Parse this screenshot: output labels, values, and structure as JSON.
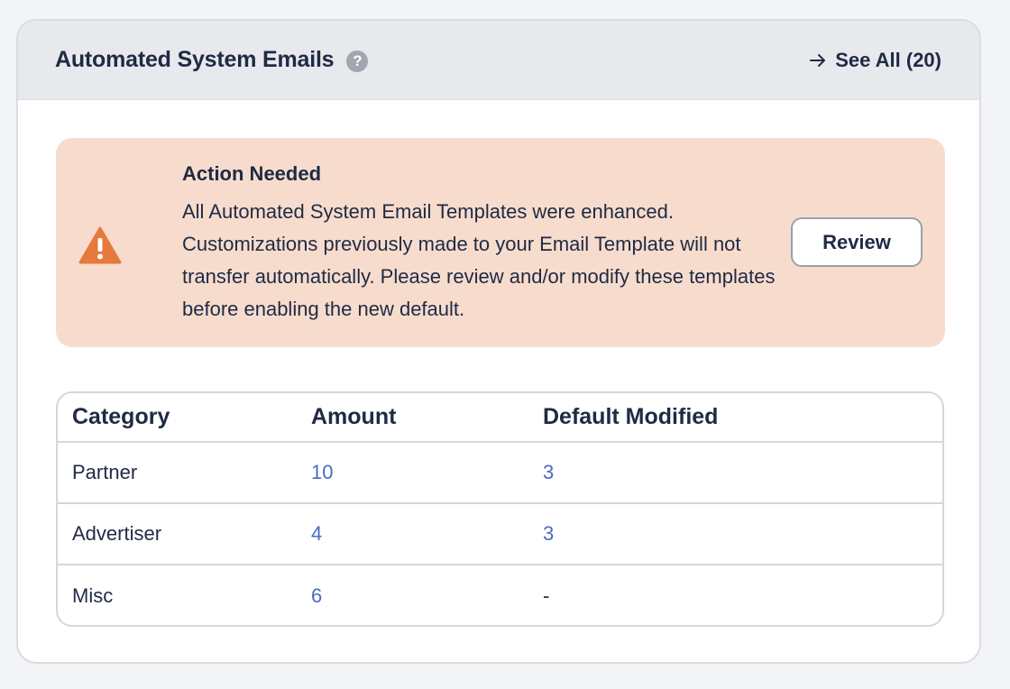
{
  "header": {
    "title": "Automated System Emails",
    "help_icon": "question-circle-icon",
    "see_all_label": "See All (20)",
    "see_all_icon": "arrow-right-icon"
  },
  "alert": {
    "icon": "warning-triangle-icon",
    "title": "Action Needed",
    "body": "All Automated System Email Templates were enhanced. Customizations previously made to your Email Template will not transfer automatically. Please review and/or modify these templates before enabling the new default.",
    "button_label": "Review",
    "background_color": "#f7dccd",
    "icon_color": "#e57a3c"
  },
  "table": {
    "headers": [
      "Category",
      "Amount",
      "Default Modified"
    ],
    "rows": [
      {
        "category": "Partner",
        "amount": "10",
        "default_modified": "3"
      },
      {
        "category": "Advertiser",
        "amount": "4",
        "default_modified": "3"
      },
      {
        "category": "Misc",
        "amount": "6",
        "default_modified": "-"
      }
    ],
    "link_color": "#4a6bbf"
  }
}
